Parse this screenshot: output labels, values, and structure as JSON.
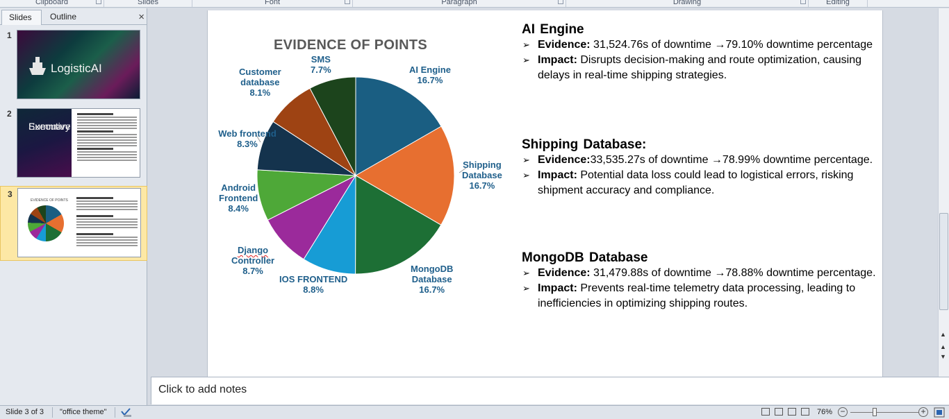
{
  "ribbon": {
    "groups": [
      "Clipboard",
      "Slides",
      "Font",
      "Paragraph",
      "Drawing",
      "Editing"
    ]
  },
  "left_pane": {
    "tabs": [
      "Slides",
      "Outline"
    ],
    "close_glyph": "×",
    "thumbnails": [
      {
        "number": "1",
        "title": "LogisticAI"
      },
      {
        "number": "2",
        "title_line1": "Executive",
        "title_line2": "Summary"
      },
      {
        "number": "3",
        "title": "EVIDENCE OF POINTS"
      }
    ]
  },
  "slide": {
    "chart_data": {
      "type": "pie",
      "title": "EVIDENCE OF POINTS",
      "slices": [
        {
          "label": "AI Engine",
          "percent_label": "16.7%",
          "value": 16.7,
          "color": "#1a5e82"
        },
        {
          "label": "Shipping Database",
          "percent_label": "16.7%",
          "value": 16.7,
          "color": "#e76f30"
        },
        {
          "label": "MongoDB Database",
          "percent_label": "16.7%",
          "value": 16.7,
          "color": "#1d6f35"
        },
        {
          "label": "IOS FRONTEND",
          "percent_label": "8.8%",
          "value": 8.8,
          "color": "#179cd5"
        },
        {
          "label": "Django Controller",
          "percent_label": "8.7%",
          "value": 8.7,
          "color": "#9b2a9b"
        },
        {
          "label": "Android Frontend",
          "percent_label": "8.4%",
          "value": 8.4,
          "color": "#4ea838"
        },
        {
          "label": "Web frontend",
          "percent_label": "8.3%",
          "value": 8.3,
          "color": "#14334d"
        },
        {
          "label": "Customer database",
          "percent_label": "8.1%",
          "value": 8.1,
          "color": "#9e4313"
        },
        {
          "label": "SMS",
          "percent_label": "7.7%",
          "value": 7.7,
          "color": "#1c441c"
        }
      ]
    },
    "labels": {
      "ai_engine": {
        "l1": "AI Engine",
        "pct": "16.7%"
      },
      "shipping": {
        "l1": "Shipping",
        "l2": "Database",
        "pct": "16.7%"
      },
      "mongodb": {
        "l1": "MongoDB",
        "l2": "Database",
        "pct": "16.7%"
      },
      "ios": {
        "l1": "IOS FRONTEND",
        "pct": "8.8%"
      },
      "django": {
        "l1": "Django",
        "l2": "Controller",
        "pct": "8.7%"
      },
      "android": {
        "l1": "Android",
        "l2": "Frontend",
        "pct": "8.4%"
      },
      "web": {
        "l1": "Web frontend",
        "pct": "8.3%"
      },
      "customer": {
        "l1": "Customer",
        "l2": "database",
        "pct": "8.1%"
      },
      "sms": {
        "l1": "SMS",
        "pct": "7.7%"
      }
    },
    "sections": [
      {
        "heading": "AI Engine",
        "evidence_label": "Evidence:",
        "evidence_text": " 31,524.76s of downtime →79.10% downtime percentage",
        "impact_label": "Impact:",
        "impact_text": " Disrupts decision-making and route optimization, causing delays in real-time shipping strategies."
      },
      {
        "heading": "Shipping Database:",
        "evidence_label": "Evidence:",
        "evidence_text": "33,535.27s of downtime →78.99% downtime percentage.",
        "impact_label": "Impact:",
        "impact_text": " Potential data loss could lead to logistical errors, risking shipment accuracy and compliance."
      },
      {
        "heading": "MongoDB Database",
        "evidence_label": "Evidence:",
        "evidence_text": " 31,479.88s of downtime →78.88% downtime percentage.",
        "impact_label": "Impact:",
        "impact_text": " Prevents real-time telemetry data processing, leading to inefficiencies in optimizing shipping routes."
      }
    ],
    "bullet_glyph": "➢"
  },
  "notes": {
    "placeholder": "Click to add notes"
  },
  "status_bar": {
    "slide_indicator": "Slide 3 of 3",
    "theme": "\"office theme\"",
    "zoom": "76%",
    "zoom_minus": "−",
    "zoom_plus": "+"
  }
}
